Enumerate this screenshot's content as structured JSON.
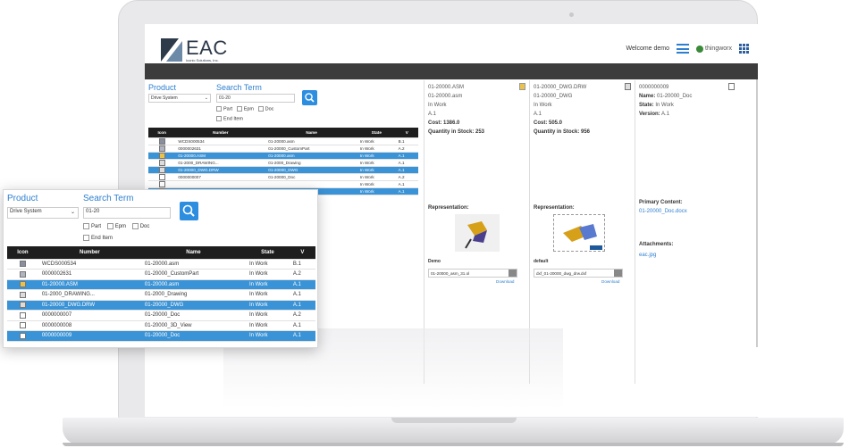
{
  "header": {
    "logo_text": "EAC",
    "logo_sub": "Iconic Solutions, Inc.",
    "welcome": "Welcome  demo",
    "thingworx": "thingworx",
    "thingworx_small": "Powered by"
  },
  "search": {
    "product_label": "Product",
    "product_value": "Drive System",
    "term_label": "Search Term",
    "term_value": "01-20",
    "part": "Part",
    "epm": "Epm",
    "doc": "Doc",
    "end_item": "End Item"
  },
  "table": {
    "columns": [
      "Icon",
      "Number",
      "Name",
      "State",
      "V"
    ],
    "rows": [
      {
        "number": "WCDS000534",
        "name": "01-20000.asm",
        "state": "In Work",
        "v": "B.1",
        "icon": "assembly-icon",
        "selected": false
      },
      {
        "number": "0000002631",
        "name": "01-20000_CustomPart",
        "state": "In Work",
        "v": "A.2",
        "icon": "part-icon",
        "selected": false
      },
      {
        "number": "01-20000.ASM",
        "name": "01-20000.asm",
        "state": "In Work",
        "v": "A.1",
        "icon": "cad-doc-icon",
        "selected": true
      },
      {
        "number": "01-2000_DRAWING...",
        "name": "01-2000_Drawing",
        "state": "In Work",
        "v": "A.1",
        "icon": "drawing-icon",
        "selected": false
      },
      {
        "number": "01-20000_DWG.DRW",
        "name": "01-20000_DWG",
        "state": "In Work",
        "v": "A.1",
        "icon": "drawing-icon",
        "selected": true
      },
      {
        "number": "0000000007",
        "name": "01-20000_Doc",
        "state": "In Work",
        "v": "A.2",
        "icon": "document-icon",
        "selected": false
      },
      {
        "number": "0000000008",
        "name": "01-20000_3D_View",
        "state": "In Work",
        "v": "A.1",
        "icon": "document-icon",
        "selected": false
      },
      {
        "number": "0000000009",
        "name": "01-20000_Doc",
        "state": "In Work",
        "v": "A.1",
        "icon": "document-icon",
        "selected": true
      }
    ],
    "bg_rows": [
      {
        "number": "WCDS000534",
        "name": "01-20000.asm",
        "state": "In Work",
        "v": "B.1",
        "selected": false
      },
      {
        "number": "0000002631",
        "name": "01-20000_CustomPart",
        "state": "In Work",
        "v": "A.2",
        "selected": false
      },
      {
        "number": "01-20000.ASM",
        "name": "01-20000.asm",
        "state": "In Work",
        "v": "A.1",
        "selected": true
      },
      {
        "number": "01-2000_DRAWING...",
        "name": "01-2000_Drawing",
        "state": "In Work",
        "v": "A.1",
        "selected": false
      },
      {
        "number": "01-20000_DWG.DRW",
        "name": "01-20000_DWG",
        "state": "In Work",
        "v": "A.1",
        "selected": true
      },
      {
        "number": "0000000007",
        "name": "01-20000_Doc",
        "state": "In Work",
        "v": "A.2",
        "selected": false
      },
      {
        "number": "",
        "name": "",
        "state": "In Work",
        "v": "A.1",
        "selected": false
      },
      {
        "number": "",
        "name": "",
        "state": "In Work",
        "v": "A.1",
        "selected": true
      }
    ]
  },
  "detail1": {
    "number": "01-20000.ASM",
    "name": "01-20000.asm",
    "state": "In Work",
    "version": "A.1",
    "cost": "Cost: 1386.0",
    "qty": "Quantity in Stock: 253",
    "repr_label": "Representation:",
    "repr_name": "Demo",
    "file": "01-20000_asm_31.ol",
    "download": "Download"
  },
  "detail2": {
    "number": "01-20000_DWG.DRW",
    "name": "01-20000_DWG",
    "state": "In Work",
    "version": "A.1",
    "cost": "Cost: 505.0",
    "qty": "Quantity in Stock: 956",
    "repr_label": "Representation:",
    "repr_name": "default",
    "file": "dxf_01-20000_dwg_drw.dxf",
    "download": "Download"
  },
  "detail3": {
    "number": "0000000009",
    "name_label": "Name:",
    "name": "01-20000_Doc",
    "state_label": "State:",
    "state": "In Work",
    "version_label": "Version:",
    "version": "A.1",
    "primary_label": "Primary Content:",
    "primary": "01-20000_Doc.docx",
    "attach_label": "Attachments:",
    "attach": "eac.jpg"
  }
}
